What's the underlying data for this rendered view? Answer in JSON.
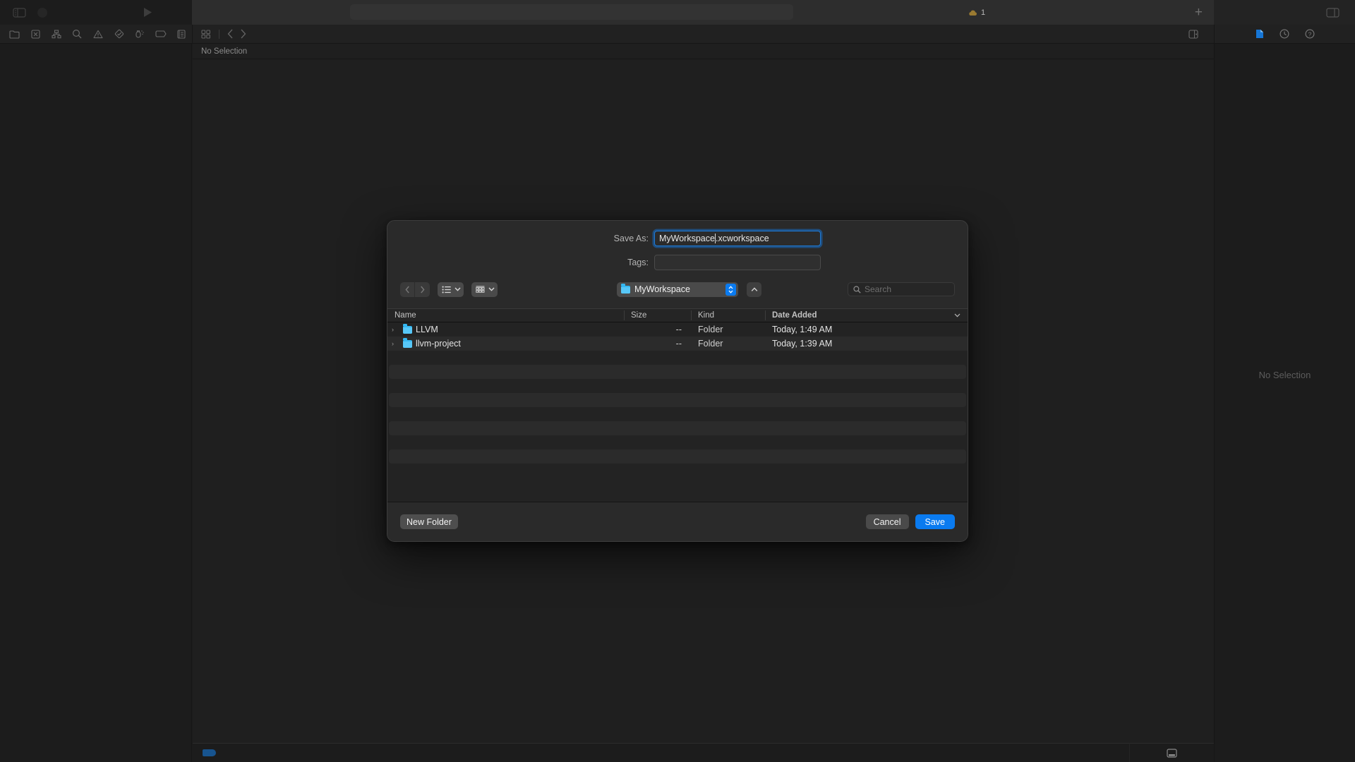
{
  "app": {
    "titlebar": {
      "sidebar_toggle_icon": "sidebar-toggle-icon",
      "run_icon": "run-play-icon",
      "warning_count": "1",
      "warning_icon": "warning-cloud-icon",
      "add_icon": "plus-icon",
      "layout_icon": "editor-layout-icon"
    },
    "navigator_toolbar": {
      "icons": [
        {
          "name": "project-navigator-icon",
          "glyph": "folder"
        },
        {
          "name": "source-control-navigator-icon",
          "glyph": "xbox"
        },
        {
          "name": "symbol-navigator-icon",
          "glyph": "hierarchy"
        },
        {
          "name": "find-navigator-icon",
          "glyph": "magnifier"
        },
        {
          "name": "issue-navigator-icon",
          "glyph": "warning"
        },
        {
          "name": "test-navigator-icon",
          "glyph": "diamond"
        },
        {
          "name": "debug-navigator-icon",
          "glyph": "debug"
        },
        {
          "name": "breakpoint-navigator-icon",
          "glyph": "tag"
        },
        {
          "name": "report-navigator-icon",
          "glyph": "report"
        }
      ]
    },
    "jumpbar": {
      "grid_icon": "related-items-icon",
      "back_icon": "chevron-left-icon",
      "forward_icon": "chevron-right-icon",
      "editor_options_icon": "editor-options-icon"
    },
    "inspector_toolbar": {
      "icons": [
        {
          "name": "file-inspector-icon",
          "glyph": "document",
          "active": true
        },
        {
          "name": "history-inspector-icon",
          "glyph": "clock",
          "active": false
        },
        {
          "name": "quick-help-inspector-icon",
          "glyph": "question",
          "active": false
        }
      ]
    },
    "editor": {
      "jumpbar_text": "No Selection"
    },
    "inspector": {
      "empty_text": "No Selection"
    },
    "statusbar": {
      "tag_chip": "blue-tag-chip",
      "debug_area_toggle_icon": "debug-area-toggle-icon"
    }
  },
  "dialog": {
    "name": "save-as-dialog",
    "fields": [
      {
        "label": "Save As:",
        "value_before_caret": "MyWorkspace",
        "value_after_caret": ".xcworkspace",
        "focused": true
      },
      {
        "label": "Tags:",
        "value": "",
        "focused": false
      }
    ],
    "toolbar": {
      "back_icon": "chevron-left-icon",
      "forward_icon": "chevron-right-icon",
      "list_view_icon": "list-view-icon",
      "icon_view_icon": "icon-view-icon",
      "view_chevron": "chevron-down-icon",
      "group_chevron": "chevron-down-icon",
      "location_label": "MyWorkspace",
      "location_folder_icon": "folder-icon",
      "location_stepper_icon": "updown-stepper-icon",
      "up_button_icon": "chevron-up-icon",
      "search_placeholder": "Search",
      "search_icon": "search-icon"
    },
    "columns": [
      {
        "key": "name",
        "label": "Name",
        "sorted": false
      },
      {
        "key": "size",
        "label": "Size",
        "sorted": false
      },
      {
        "key": "kind",
        "label": "Kind",
        "sorted": false
      },
      {
        "key": "date",
        "label": "Date Added",
        "sorted": true,
        "sort_chevron": "chevron-down-icon"
      }
    ],
    "rows": [
      {
        "name": "LLVM",
        "size": "--",
        "kind": "Folder",
        "date": "Today, 1:49 AM",
        "icon": "folder-icon",
        "disclosure": "chevron-right-icon"
      },
      {
        "name": "llvm-project",
        "size": "--",
        "kind": "Folder",
        "date": "Today, 1:39 AM",
        "icon": "folder-icon",
        "disclosure": "chevron-right-icon"
      }
    ],
    "empty_row_count": 9,
    "buttons": {
      "new_folder": "New Folder",
      "cancel": "Cancel",
      "save": "Save"
    }
  },
  "colors": {
    "accent_blue": "#0a7bf0",
    "focus_ring": "#1e7ad6",
    "folder_blue": "#34b7f1",
    "dialog_bg": "#2a2a2a",
    "window_bg": "#1c1c1c"
  }
}
